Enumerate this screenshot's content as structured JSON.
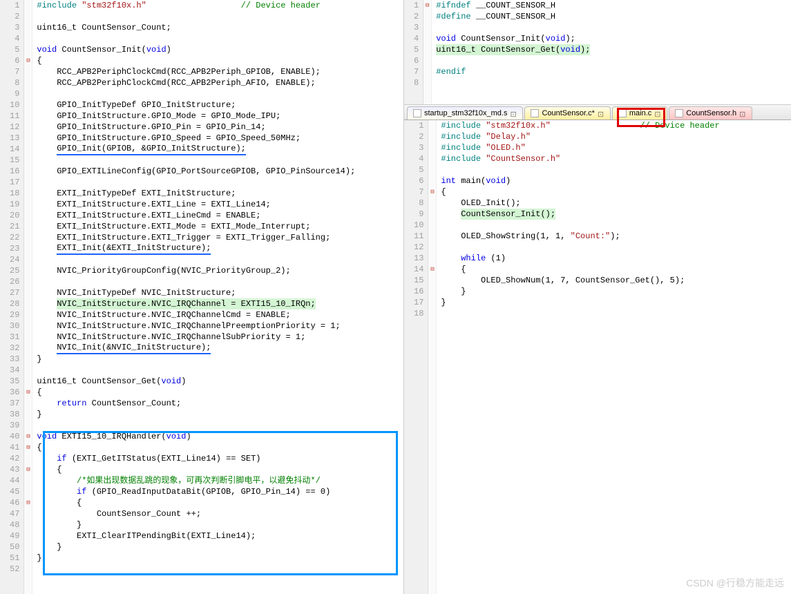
{
  "watermark": "CSDN @行稳方能走远",
  "left": {
    "device_header_comment": "// Device header",
    "lines": [
      {
        "n": 1,
        "tokens": [
          {
            "t": "#include ",
            "c": "pp"
          },
          {
            "t": "\"stm32f10x.h\"",
            "c": "str"
          },
          {
            "t": "                   ",
            "c": ""
          },
          {
            "t": "// Device header",
            "c": "cmt"
          }
        ]
      },
      {
        "n": 2,
        "tokens": []
      },
      {
        "n": 3,
        "tokens": [
          {
            "t": "uint16_t CountSensor_Count;",
            "c": "ident"
          }
        ]
      },
      {
        "n": 4,
        "tokens": []
      },
      {
        "n": 5,
        "tokens": [
          {
            "t": "void",
            "c": "kw"
          },
          {
            "t": " CountSensor_Init(",
            "c": "ident"
          },
          {
            "t": "void",
            "c": "kw"
          },
          {
            "t": ")",
            "c": "ident"
          }
        ]
      },
      {
        "n": 6,
        "fold": "⊟",
        "tokens": [
          {
            "t": "{",
            "c": "ident"
          }
        ]
      },
      {
        "n": 7,
        "tokens": [
          {
            "t": "    RCC_APB2PeriphClockCmd(RCC_APB2Periph_GPIOB, ENABLE);",
            "c": "ident"
          }
        ]
      },
      {
        "n": 8,
        "tokens": [
          {
            "t": "    RCC_APB2PeriphClockCmd(RCC_APB2Periph_AFIO, ENABLE);",
            "c": "ident"
          }
        ]
      },
      {
        "n": 9,
        "tokens": []
      },
      {
        "n": 10,
        "tokens": [
          {
            "t": "    GPIO_InitTypeDef GPIO_InitStructure;",
            "c": "ident"
          }
        ]
      },
      {
        "n": 11,
        "tokens": [
          {
            "t": "    GPIO_InitStructure.GPIO_Mode = GPIO_Mode_IPU;",
            "c": "ident"
          }
        ]
      },
      {
        "n": 12,
        "tokens": [
          {
            "t": "    GPIO_InitStructure.GPIO_Pin = GPIO_Pin_14;",
            "c": "ident"
          }
        ]
      },
      {
        "n": 13,
        "tokens": [
          {
            "t": "    GPIO_InitStructure.GPIO_Speed = GPIO_Speed_50MHz;",
            "c": "ident"
          }
        ]
      },
      {
        "n": 14,
        "tokens": [
          {
            "t": "    ",
            "c": ""
          },
          {
            "t": "GPIO_Init(GPIOB, &GPIO_InitStructure);",
            "c": "ident",
            "ul": true
          }
        ]
      },
      {
        "n": 15,
        "tokens": []
      },
      {
        "n": 16,
        "tokens": [
          {
            "t": "    GPIO_EXTILineConfig(GPIO_PortSourceGPIOB, GPIO_PinSource14);",
            "c": "ident"
          }
        ]
      },
      {
        "n": 17,
        "tokens": []
      },
      {
        "n": 18,
        "tokens": [
          {
            "t": "    EXTI_InitTypeDef EXTI_InitStructure;",
            "c": "ident"
          }
        ]
      },
      {
        "n": 19,
        "tokens": [
          {
            "t": "    EXTI_InitStructure.EXTI_Line = EXTI_Line14;",
            "c": "ident"
          }
        ]
      },
      {
        "n": 20,
        "tokens": [
          {
            "t": "    EXTI_InitStructure.EXTI_LineCmd = ENABLE;",
            "c": "ident"
          }
        ]
      },
      {
        "n": 21,
        "tokens": [
          {
            "t": "    EXTI_InitStructure.EXTI_Mode = EXTI_Mode_Interrupt;",
            "c": "ident"
          }
        ]
      },
      {
        "n": 22,
        "tokens": [
          {
            "t": "    EXTI_InitStructure.EXTI_Trigger = EXTI_Trigger_Falling;",
            "c": "ident"
          }
        ]
      },
      {
        "n": 23,
        "tokens": [
          {
            "t": "    ",
            "c": ""
          },
          {
            "t": "EXTI_Init(&EXTI_InitStructure);",
            "c": "ident",
            "ul": true
          }
        ]
      },
      {
        "n": 24,
        "tokens": []
      },
      {
        "n": 25,
        "tokens": [
          {
            "t": "    NVIC_PriorityGroupConfig(NVIC_PriorityGroup_2);",
            "c": "ident"
          }
        ]
      },
      {
        "n": 26,
        "tokens": []
      },
      {
        "n": 27,
        "tokens": [
          {
            "t": "    NVIC_InitTypeDef NVIC_InitStructure;",
            "c": "ident"
          }
        ]
      },
      {
        "n": 28,
        "tokens": [
          {
            "t": "    ",
            "c": ""
          },
          {
            "t": "NVIC_InitStructure.NVIC_IRQChannel = EXTI15_10_IRQn;",
            "c": "ident",
            "hl": "green"
          }
        ]
      },
      {
        "n": 29,
        "tokens": [
          {
            "t": "    NVIC_InitStructure.NVIC_IRQChannelCmd = ENABLE;",
            "c": "ident"
          }
        ]
      },
      {
        "n": 30,
        "tokens": [
          {
            "t": "    NVIC_InitStructure.NVIC_IRQChannelPreemptionPriority = 1;",
            "c": "ident"
          }
        ]
      },
      {
        "n": 31,
        "tokens": [
          {
            "t": "    NVIC_InitStructure.NVIC_IRQChannelSubPriority = 1;",
            "c": "ident"
          }
        ]
      },
      {
        "n": 32,
        "tokens": [
          {
            "t": "    ",
            "c": ""
          },
          {
            "t": "NVIC_Init(&NVIC_InitStructure);",
            "c": "ident",
            "ul": true
          }
        ]
      },
      {
        "n": 33,
        "tokens": [
          {
            "t": "}",
            "c": "ident"
          }
        ]
      },
      {
        "n": 34,
        "tokens": []
      },
      {
        "n": 35,
        "tokens": [
          {
            "t": "uint16_t CountSensor_Get(",
            "c": "ident"
          },
          {
            "t": "void",
            "c": "kw"
          },
          {
            "t": ")",
            "c": "ident"
          }
        ]
      },
      {
        "n": 36,
        "fold": "⊟",
        "tokens": [
          {
            "t": "{",
            "c": "ident"
          }
        ]
      },
      {
        "n": 37,
        "tokens": [
          {
            "t": "    ",
            "c": ""
          },
          {
            "t": "return",
            "c": "kw"
          },
          {
            "t": " CountSensor_Count;",
            "c": "ident"
          }
        ]
      },
      {
        "n": 38,
        "tokens": [
          {
            "t": "}",
            "c": "ident"
          }
        ]
      },
      {
        "n": 39,
        "tokens": []
      },
      {
        "n": 40,
        "fold": "⊟",
        "tokens": [
          {
            "t": "void",
            "c": "kw"
          },
          {
            "t": " EXTI15_10_IRQHandler(",
            "c": "ident"
          },
          {
            "t": "void",
            "c": "kw"
          },
          {
            "t": ")",
            "c": "ident"
          }
        ]
      },
      {
        "n": 41,
        "fold": "⊟",
        "tokens": [
          {
            "t": "{",
            "c": "ident"
          }
        ]
      },
      {
        "n": 42,
        "tokens": [
          {
            "t": "    ",
            "c": ""
          },
          {
            "t": "if",
            "c": "kw"
          },
          {
            "t": " (EXTI_GetITStatus(EXTI_Line14) == SET)",
            "c": "ident"
          }
        ]
      },
      {
        "n": 43,
        "fold": "⊟",
        "tokens": [
          {
            "t": "    {",
            "c": "ident"
          }
        ]
      },
      {
        "n": 44,
        "tokens": [
          {
            "t": "        ",
            "c": ""
          },
          {
            "t": "/*如果出现数据乱跳的现象，可再次判断引脚电平，以避免抖动*/",
            "c": "cmt"
          }
        ]
      },
      {
        "n": 45,
        "tokens": [
          {
            "t": "        ",
            "c": ""
          },
          {
            "t": "if",
            "c": "kw"
          },
          {
            "t": " (GPIO_ReadInputDataBit(GPIOB, GPIO_Pin_14) == 0)",
            "c": "ident"
          }
        ]
      },
      {
        "n": 46,
        "fold": "⊟",
        "tokens": [
          {
            "t": "        {",
            "c": "ident"
          }
        ]
      },
      {
        "n": 47,
        "tokens": [
          {
            "t": "            CountSensor_Count ++;",
            "c": "ident"
          }
        ]
      },
      {
        "n": 48,
        "tokens": [
          {
            "t": "        }",
            "c": "ident"
          }
        ]
      },
      {
        "n": 49,
        "tokens": [
          {
            "t": "        EXTI_ClearITPendingBit(EXTI_Line14);",
            "c": "ident"
          }
        ]
      },
      {
        "n": 50,
        "tokens": [
          {
            "t": "    }",
            "c": "ident"
          }
        ]
      },
      {
        "n": 51,
        "tokens": [
          {
            "t": "}",
            "c": "ident"
          }
        ]
      },
      {
        "n": 52,
        "tokens": []
      }
    ]
  },
  "right_top": {
    "lines": [
      {
        "n": 1,
        "fold": "⊟",
        "tokens": [
          {
            "t": "#ifndef ",
            "c": "pp"
          },
          {
            "t": "__COUNT_SENSOR_H",
            "c": "ident"
          }
        ]
      },
      {
        "n": 2,
        "tokens": [
          {
            "t": "#define ",
            "c": "pp"
          },
          {
            "t": "__COUNT_SENSOR_H",
            "c": "ident"
          }
        ]
      },
      {
        "n": 3,
        "tokens": []
      },
      {
        "n": 4,
        "tokens": [
          {
            "t": "void",
            "c": "kw"
          },
          {
            "t": " CountSensor_Init(",
            "c": "ident"
          },
          {
            "t": "void",
            "c": "kw"
          },
          {
            "t": ");",
            "c": "ident"
          }
        ]
      },
      {
        "n": 5,
        "tokens": [
          {
            "t": "uint16_t CountSensor_Get(",
            "c": "ident",
            "hl": "green"
          },
          {
            "t": "void",
            "c": "kw",
            "hl": "green"
          },
          {
            "t": ");",
            "c": "ident",
            "hl": "green"
          }
        ]
      },
      {
        "n": 6,
        "tokens": []
      },
      {
        "n": 7,
        "tokens": [
          {
            "t": "#endif",
            "c": "pp"
          }
        ]
      },
      {
        "n": 8,
        "tokens": []
      }
    ]
  },
  "tabs": [
    {
      "label": "startup_stm32f10x_md.s",
      "cls": "s-file"
    },
    {
      "label": "CountSensor.c*",
      "cls": "c-file"
    },
    {
      "label": "main.c",
      "cls": "c-file",
      "boxed": true
    },
    {
      "label": "CountSensor.h",
      "cls": "h-file"
    }
  ],
  "right_bottom": {
    "lines": [
      {
        "n": 1,
        "tokens": [
          {
            "t": "#include ",
            "c": "pp"
          },
          {
            "t": "\"stm32f10x.h\"",
            "c": "str"
          },
          {
            "t": "                  ",
            "c": ""
          },
          {
            "t": "// Device header",
            "c": "cmt"
          }
        ]
      },
      {
        "n": 2,
        "tokens": [
          {
            "t": "#include ",
            "c": "pp"
          },
          {
            "t": "\"Delay.h\"",
            "c": "str"
          }
        ]
      },
      {
        "n": 3,
        "tokens": [
          {
            "t": "#include ",
            "c": "pp"
          },
          {
            "t": "\"OLED.h\"",
            "c": "str"
          }
        ]
      },
      {
        "n": 4,
        "tokens": [
          {
            "t": "#include ",
            "c": "pp"
          },
          {
            "t": "\"CountSensor.h\"",
            "c": "str"
          }
        ]
      },
      {
        "n": 5,
        "tokens": []
      },
      {
        "n": 6,
        "tokens": [
          {
            "t": "int",
            "c": "kw"
          },
          {
            "t": " main(",
            "c": "ident"
          },
          {
            "t": "void",
            "c": "kw"
          },
          {
            "t": ")",
            "c": "ident"
          }
        ]
      },
      {
        "n": 7,
        "fold": "⊟",
        "tokens": [
          {
            "t": "{",
            "c": "ident"
          }
        ]
      },
      {
        "n": 8,
        "tokens": [
          {
            "t": "    OLED_Init();",
            "c": "ident"
          }
        ]
      },
      {
        "n": 9,
        "tokens": [
          {
            "t": "    ",
            "c": ""
          },
          {
            "t": "CountSensor_Init();",
            "c": "ident",
            "hl": "green"
          }
        ]
      },
      {
        "n": 10,
        "tokens": []
      },
      {
        "n": 11,
        "tokens": [
          {
            "t": "    OLED_ShowString(1, 1, ",
            "c": "ident"
          },
          {
            "t": "\"Count:\"",
            "c": "str"
          },
          {
            "t": ");",
            "c": "ident"
          }
        ]
      },
      {
        "n": 12,
        "tokens": []
      },
      {
        "n": 13,
        "tokens": [
          {
            "t": "    ",
            "c": ""
          },
          {
            "t": "while",
            "c": "kw"
          },
          {
            "t": " (1)",
            "c": "ident"
          }
        ]
      },
      {
        "n": 14,
        "fold": "⊟",
        "tokens": [
          {
            "t": "    {",
            "c": "ident"
          }
        ]
      },
      {
        "n": 15,
        "tokens": [
          {
            "t": "        OLED_ShowNum(1, 7, CountSensor_Get(), 5);",
            "c": "ident"
          }
        ]
      },
      {
        "n": 16,
        "tokens": [
          {
            "t": "    }",
            "c": "ident"
          }
        ]
      },
      {
        "n": 17,
        "tokens": [
          {
            "t": "}",
            "c": "ident"
          }
        ]
      },
      {
        "n": 18,
        "tokens": []
      }
    ]
  },
  "blue_box": {
    "note": "surrounds lines 40-51 in left pane"
  },
  "red_box": {
    "note": "surrounds main.c tab"
  }
}
